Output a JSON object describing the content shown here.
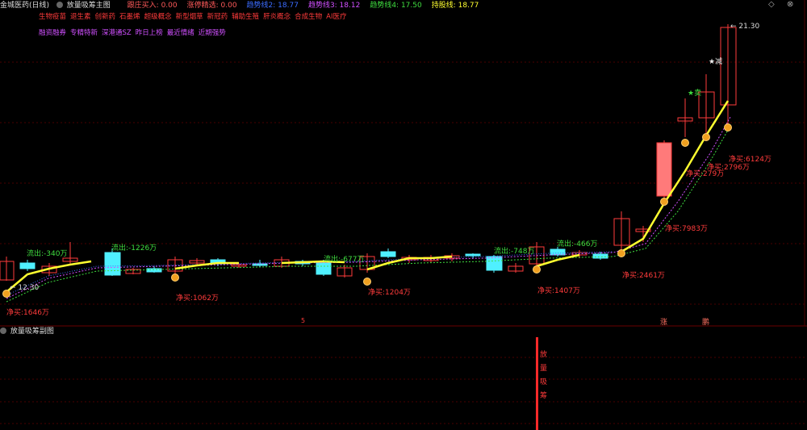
{
  "main_header": {
    "stock_name": "金城医药(日线)",
    "indicator_name": "放量吸筹主图",
    "fields": [
      {
        "label": "跟庄买入: 0.00",
        "color": "#ff5a5a"
      },
      {
        "label": "涨停精选: 0.00",
        "color": "#ff5a5a"
      },
      {
        "label": "趋势线2: 18.77",
        "color": "#3b6cff"
      },
      {
        "label": "趋势线3: 18.12",
        "color": "#d050ff"
      },
      {
        "label": "趋势线4: 17.50",
        "color": "#3fdc3f"
      },
      {
        "label": "持股线: 18.77",
        "color": "#ffff30"
      }
    ]
  },
  "concept_tags_row1": [
    "生物疫苗",
    "退生素",
    "创新药",
    "石墨烯",
    "超级概念",
    "新型烟草",
    "新冠药",
    "辅助生殖",
    "肝炎概念",
    "合成生物",
    "AI医疗"
  ],
  "concept_tags_row2": [
    "融资融券",
    "专精特新",
    "深港通SZ",
    "昨日上榜",
    "最近情绪",
    "近期强势"
  ],
  "sub_header": {
    "indicator_name": "放量吸筹副图"
  },
  "top_right_icons": [
    "diamond-icon",
    "settings-icon"
  ],
  "chart_labels": {
    "low_price": "12.30",
    "high_price": "21.30",
    "sell_star": "★卖",
    "reduce_star": "★减",
    "outflows": [
      "流出:-340万",
      "流出:-1226万",
      "流出:-677万",
      "流出:-748万",
      "流出:-466万"
    ],
    "net_buys": [
      "净买:1646万",
      "净买:1062万",
      "净买:1204万",
      "净买:1407万",
      "净买:2461万",
      "净买:7983万",
      "净买:2796万",
      "净买:6124万"
    ],
    "net_buy_279": "净买:279万",
    "date_marks": [
      "5",
      "涨",
      "鹏"
    ],
    "sub_vertical_text": [
      "放",
      "量",
      "吸",
      "筹"
    ]
  },
  "colors": {
    "up": "#ff3b3b",
    "down": "#4ff0ff",
    "holding_line": "#ffff30",
    "grid": "#5a0000"
  },
  "chart_data": {
    "type": "candlestick",
    "title": "",
    "price_marks": {
      "low": 12.3,
      "high": 21.3
    },
    "candles_approx": [
      {
        "o": 13.0,
        "h": 13.1,
        "l": 12.3,
        "c": 12.6
      },
      {
        "o": 12.9,
        "h": 13.1,
        "l": 12.8,
        "c": 12.8
      },
      {
        "o": 12.9,
        "h": 13.2,
        "l": 12.7,
        "c": 13.0
      },
      {
        "o": 13.0,
        "h": 13.3,
        "l": 12.8,
        "c": 13.1
      },
      {
        "o": 13.2,
        "h": 13.3,
        "l": 12.6,
        "c": 12.6
      },
      {
        "o": 12.8,
        "h": 12.8,
        "l": 12.7,
        "c": 12.7
      },
      {
        "o": 12.7,
        "h": 12.7,
        "l": 12.7,
        "c": 12.7
      },
      {
        "o": 12.8,
        "h": 13.0,
        "l": 12.7,
        "c": 13.0
      },
      {
        "o": 13.0,
        "h": 13.0,
        "l": 12.8,
        "c": 12.8
      },
      {
        "o": 12.9,
        "h": 12.9,
        "l": 12.8,
        "c": 12.9
      },
      {
        "o": 13.0,
        "h": 13.0,
        "l": 12.9,
        "c": 13.0
      },
      {
        "o": 12.9,
        "h": 13.0,
        "l": 12.8,
        "c": 12.9
      }
    ]
  }
}
